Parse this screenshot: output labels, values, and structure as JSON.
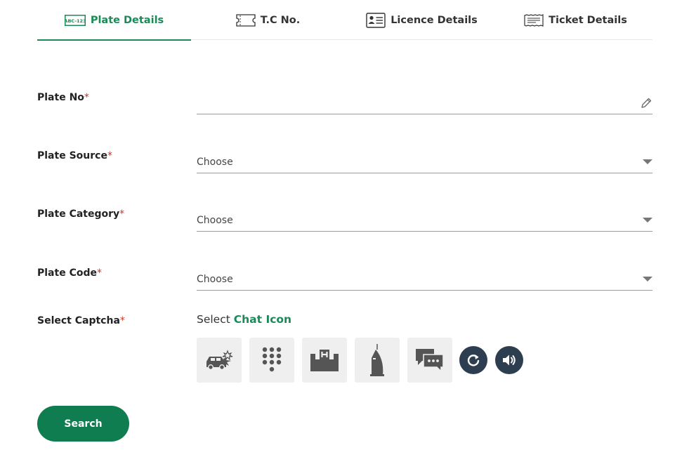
{
  "tabs": [
    {
      "label": "Plate Details",
      "icon": "plate-icon",
      "active": true
    },
    {
      "label": "T.C No.",
      "icon": "ticket-card-icon",
      "active": false
    },
    {
      "label": "Licence Details",
      "icon": "licence-card-icon",
      "active": false
    },
    {
      "label": "Ticket Details",
      "icon": "ticket-receipt-icon",
      "active": false
    }
  ],
  "plate_icon_text": "ABC-123",
  "fields": {
    "plate_no": {
      "label": "Plate No",
      "required_mark": "*",
      "value": ""
    },
    "plate_source": {
      "label": "Plate Source",
      "required_mark": "*",
      "value": "Choose"
    },
    "plate_category": {
      "label": "Plate Category",
      "required_mark": "*",
      "value": "Choose"
    },
    "plate_code": {
      "label": "Plate Code",
      "required_mark": "*",
      "value": "Choose"
    }
  },
  "captcha": {
    "label": "Select Captcha",
    "required_mark": "*",
    "prompt_prefix": "Select",
    "prompt_target": "Chat Icon",
    "options": [
      "car-crash-icon",
      "keypad-icon",
      "hospital-icon",
      "burj-al-arab-icon",
      "chat-icon"
    ],
    "refresh_icon": "refresh-icon",
    "audio_icon": "speaker-icon"
  },
  "search_label": "Search",
  "colors": {
    "accent": "#1a8a56",
    "button": "#0f7d4f",
    "required": "#c0392b",
    "round_button": "#2c3e50",
    "tile": "#efefef"
  }
}
